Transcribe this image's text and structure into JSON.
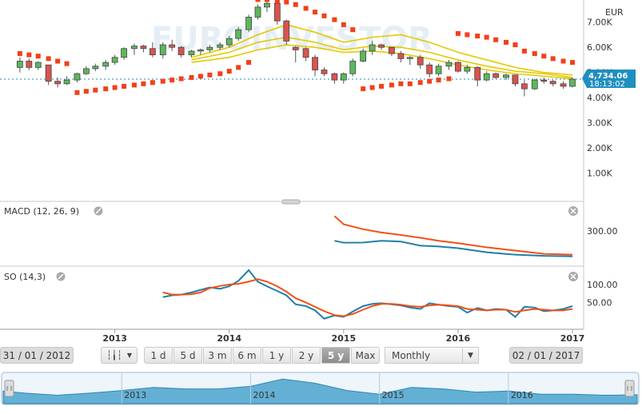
{
  "header": {
    "currency": "EUR"
  },
  "price": {
    "last": "4,734.06",
    "time": "18:13:02"
  },
  "panels": {
    "macd": {
      "title": "MACD (12, 26, 9)"
    },
    "so": {
      "title": "SO (14,3)"
    }
  },
  "controls": {
    "start_date": "31 / 01 / 2012",
    "end_date": "02 / 01 / 2017",
    "ranges": [
      "1 d",
      "5 d",
      "3 m",
      "6 m",
      "1 y",
      "2 y",
      "5 y",
      "Max"
    ],
    "active_range": "5 y",
    "interval": "Monthly"
  },
  "navigator": {
    "years": [
      "2013",
      "2014",
      "2015",
      "2016"
    ]
  },
  "colors": {
    "up": "#5cb85c",
    "down": "#d9534f",
    "psar": "#f2401a",
    "ma": "#e6c800",
    "macd_line": "#1f7fa8",
    "signal_line": "#f25018",
    "so_k": "#1f7fa8",
    "so_d": "#f25018",
    "last_price": "#1f8fbf"
  },
  "chart_data": [
    {
      "type": "candlestick",
      "name": "price",
      "y_ticks": [
        "1.00K",
        "2.00K",
        "3.00K",
        "4.00K",
        "5.00K",
        "6.00K",
        "7.00K"
      ],
      "ylim": [
        0,
        7500
      ],
      "x_ticks": [
        "2013",
        "2014",
        "2015",
        "2016",
        "2017"
      ],
      "xlim": [
        2012.08,
        2017.0
      ],
      "last_price": 4734.06,
      "candles": [
        [
          2012.17,
          5200,
          5600,
          5000,
          5450
        ],
        [
          2012.25,
          5450,
          5550,
          5100,
          5200
        ],
        [
          2012.33,
          5200,
          5450,
          5100,
          5400
        ],
        [
          2012.42,
          5300,
          5300,
          4500,
          4650
        ],
        [
          2012.5,
          4650,
          4800,
          4400,
          4550
        ],
        [
          2012.58,
          4550,
          4850,
          4500,
          4700
        ],
        [
          2012.67,
          4700,
          5000,
          4600,
          4950
        ],
        [
          2012.75,
          4950,
          5250,
          4900,
          5150
        ],
        [
          2012.83,
          5150,
          5350,
          5050,
          5250
        ],
        [
          2012.92,
          5250,
          5500,
          5100,
          5400
        ],
        [
          2013.0,
          5400,
          5700,
          5300,
          5600
        ],
        [
          2013.08,
          5600,
          6000,
          5500,
          5950
        ],
        [
          2013.17,
          5950,
          6150,
          5700,
          6050
        ],
        [
          2013.25,
          6050,
          6100,
          5800,
          5950
        ],
        [
          2013.33,
          5950,
          6200,
          5600,
          5700
        ],
        [
          2013.42,
          5700,
          6200,
          5550,
          6100
        ],
        [
          2013.5,
          6100,
          6300,
          5850,
          6000
        ],
        [
          2013.58,
          6000,
          6050,
          5600,
          5700
        ],
        [
          2013.67,
          5700,
          5900,
          5600,
          5850
        ],
        [
          2013.75,
          5850,
          5950,
          5700,
          5900
        ],
        [
          2013.83,
          5900,
          6100,
          5800,
          6000
        ],
        [
          2013.92,
          6000,
          6200,
          5900,
          6100
        ],
        [
          2014.0,
          6100,
          6450,
          6000,
          6350
        ],
        [
          2014.08,
          6350,
          6800,
          6250,
          6700
        ],
        [
          2014.17,
          6700,
          7300,
          6600,
          7200
        ],
        [
          2014.25,
          7200,
          7700,
          7100,
          7600
        ],
        [
          2014.33,
          7600,
          7850,
          7400,
          7750
        ],
        [
          2014.42,
          7750,
          7800,
          6900,
          7050
        ],
        [
          2014.5,
          7050,
          7100,
          6100,
          6250
        ],
        [
          2014.58,
          6000,
          6050,
          5400,
          5900
        ],
        [
          2014.67,
          5950,
          6000,
          5450,
          5600
        ],
        [
          2014.75,
          5600,
          5700,
          4850,
          5100
        ],
        [
          2014.83,
          5100,
          5200,
          4850,
          4950
        ],
        [
          2014.92,
          4950,
          5000,
          4550,
          4700
        ],
        [
          2015.0,
          4700,
          5000,
          4550,
          4950
        ],
        [
          2015.08,
          4950,
          5550,
          4850,
          5450
        ],
        [
          2015.17,
          5450,
          5950,
          5400,
          5850
        ],
        [
          2015.25,
          5850,
          6250,
          5700,
          6100
        ],
        [
          2015.33,
          6100,
          6150,
          5900,
          6000
        ],
        [
          2015.42,
          6000,
          6000,
          5650,
          5750
        ],
        [
          2015.5,
          5750,
          5850,
          5400,
          5550
        ],
        [
          2015.58,
          5550,
          5650,
          5300,
          5600
        ],
        [
          2015.67,
          5600,
          5700,
          5150,
          5300
        ],
        [
          2015.75,
          5300,
          5400,
          4800,
          4950
        ],
        [
          2015.83,
          4950,
          5350,
          4850,
          5250
        ],
        [
          2015.92,
          5250,
          5500,
          5100,
          5400
        ],
        [
          2016.0,
          5400,
          5450,
          5000,
          5050
        ],
        [
          2016.08,
          5050,
          5300,
          4950,
          5200
        ],
        [
          2016.17,
          5200,
          5250,
          4450,
          4700
        ],
        [
          2016.25,
          4700,
          5050,
          4650,
          4950
        ],
        [
          2016.33,
          4950,
          5000,
          4750,
          4800
        ],
        [
          2016.42,
          4800,
          4950,
          4700,
          4900
        ],
        [
          2016.5,
          4900,
          4900,
          4450,
          4550
        ],
        [
          2016.58,
          4550,
          4700,
          4050,
          4350
        ],
        [
          2016.67,
          4350,
          4750,
          4300,
          4700
        ],
        [
          2016.75,
          4700,
          4800,
          4550,
          4650
        ],
        [
          2016.83,
          4650,
          4700,
          4450,
          4550
        ],
        [
          2016.92,
          4550,
          4650,
          4350,
          4450
        ],
        [
          2017.0,
          4450,
          4800,
          4400,
          4734
        ]
      ],
      "psar": [
        [
          2012.17,
          5750
        ],
        [
          2012.25,
          5700
        ],
        [
          2012.33,
          5650
        ],
        [
          2012.42,
          5550
        ],
        [
          2012.5,
          5450
        ],
        [
          2012.58,
          5350
        ],
        [
          2012.67,
          4200
        ],
        [
          2012.75,
          4250
        ],
        [
          2012.83,
          4300
        ],
        [
          2012.92,
          4350
        ],
        [
          2013.0,
          4400
        ],
        [
          2013.08,
          4450
        ],
        [
          2013.17,
          4500
        ],
        [
          2013.25,
          4550
        ],
        [
          2013.33,
          4600
        ],
        [
          2013.42,
          4650
        ],
        [
          2013.5,
          4700
        ],
        [
          2013.58,
          4750
        ],
        [
          2013.67,
          4800
        ],
        [
          2013.75,
          4850
        ],
        [
          2013.83,
          4900
        ],
        [
          2013.92,
          4950
        ],
        [
          2014.0,
          5050
        ],
        [
          2014.08,
          5200
        ],
        [
          2014.17,
          5400
        ],
        [
          2014.25,
          7900
        ],
        [
          2014.33,
          7900
        ],
        [
          2014.42,
          7850
        ],
        [
          2014.5,
          7800
        ],
        [
          2014.58,
          7700
        ],
        [
          2014.67,
          7550
        ],
        [
          2014.75,
          7400
        ],
        [
          2014.83,
          7250
        ],
        [
          2014.92,
          7100
        ],
        [
          2015.0,
          6900
        ],
        [
          2015.08,
          6700
        ],
        [
          2015.17,
          4350
        ],
        [
          2015.25,
          4400
        ],
        [
          2015.33,
          4450
        ],
        [
          2015.42,
          4500
        ],
        [
          2015.5,
          4550
        ],
        [
          2015.58,
          4550
        ],
        [
          2015.67,
          4600
        ],
        [
          2015.75,
          4650
        ],
        [
          2015.83,
          4700
        ],
        [
          2015.92,
          4750
        ],
        [
          2016.0,
          6550
        ],
        [
          2016.08,
          6500
        ],
        [
          2016.17,
          6450
        ],
        [
          2016.25,
          6400
        ],
        [
          2016.33,
          6300
        ],
        [
          2016.42,
          6200
        ],
        [
          2016.5,
          6100
        ],
        [
          2016.58,
          5850
        ],
        [
          2016.67,
          5750
        ],
        [
          2016.75,
          5650
        ],
        [
          2016.83,
          5550
        ],
        [
          2016.92,
          5450
        ],
        [
          2017.0,
          5400
        ]
      ],
      "moving_averages": [
        [
          [
            2013.67,
            5600
          ],
          [
            2014.0,
            6000
          ],
          [
            2014.25,
            6500
          ],
          [
            2014.5,
            6900
          ],
          [
            2014.75,
            6600
          ],
          [
            2015.0,
            6200
          ],
          [
            2015.25,
            6400
          ],
          [
            2015.5,
            6500
          ],
          [
            2015.75,
            6200
          ],
          [
            2016.0,
            5800
          ],
          [
            2016.25,
            5500
          ],
          [
            2016.5,
            5200
          ],
          [
            2016.75,
            5000
          ],
          [
            2017.0,
            4900
          ]
        ],
        [
          [
            2013.67,
            5500
          ],
          [
            2014.0,
            5800
          ],
          [
            2014.25,
            6200
          ],
          [
            2014.5,
            6400
          ],
          [
            2014.75,
            6200
          ],
          [
            2015.0,
            5900
          ],
          [
            2015.25,
            6050
          ],
          [
            2015.5,
            6000
          ],
          [
            2015.75,
            5800
          ],
          [
            2016.0,
            5500
          ],
          [
            2016.25,
            5250
          ],
          [
            2016.5,
            5050
          ],
          [
            2016.75,
            4950
          ],
          [
            2017.0,
            4800
          ]
        ],
        [
          [
            2013.67,
            5400
          ],
          [
            2014.0,
            5600
          ],
          [
            2014.25,
            5900
          ],
          [
            2014.5,
            6100
          ],
          [
            2014.75,
            6000
          ],
          [
            2015.0,
            5800
          ],
          [
            2015.25,
            5850
          ],
          [
            2015.5,
            5750
          ],
          [
            2015.75,
            5550
          ],
          [
            2016.0,
            5300
          ],
          [
            2016.25,
            5100
          ],
          [
            2016.5,
            4950
          ],
          [
            2016.75,
            4850
          ],
          [
            2017.0,
            4750
          ]
        ]
      ]
    },
    {
      "type": "line",
      "name": "macd",
      "title": "MACD (12, 26, 9)",
      "y_ticks": [
        "300.00"
      ],
      "ylim": [
        100,
        450
      ],
      "series": [
        {
          "name": "MACD",
          "x": [
            2014.92,
            2015.0,
            2015.17,
            2015.33,
            2015.5,
            2015.67,
            2015.83,
            2016.0,
            2016.25,
            2016.5,
            2016.75,
            2017.0
          ],
          "values": [
            240,
            228,
            229,
            240,
            235,
            210,
            205,
            195,
            170,
            155,
            148,
            145
          ]
        },
        {
          "name": "Signal",
          "x": [
            2014.92,
            2015.0,
            2015.17,
            2015.33,
            2015.5,
            2015.67,
            2015.83,
            2016.0,
            2016.25,
            2016.5,
            2016.75,
            2017.0
          ],
          "values": [
            390,
            340,
            310,
            290,
            275,
            258,
            240,
            225,
            200,
            180,
            160,
            155
          ]
        }
      ]
    },
    {
      "type": "line",
      "name": "so",
      "title": "SO (14,3)",
      "y_ticks": [
        "100.00",
        "50.00"
      ],
      "ylim": [
        -20,
        140
      ],
      "series": [
        {
          "name": "%K",
          "x": [
            2013.42,
            2013.5,
            2013.58,
            2013.67,
            2013.75,
            2013.83,
            2013.92,
            2014.0,
            2014.08,
            2014.17,
            2014.25,
            2014.33,
            2014.42,
            2014.5,
            2014.58,
            2014.67,
            2014.75,
            2014.83,
            2014.92,
            2015.0,
            2015.08,
            2015.17,
            2015.25,
            2015.33,
            2015.42,
            2015.5,
            2015.58,
            2015.67,
            2015.75,
            2015.83,
            2015.92,
            2016.0,
            2016.08,
            2016.17,
            2016.25,
            2016.33,
            2016.42,
            2016.5,
            2016.58,
            2016.67,
            2016.75,
            2016.83,
            2016.92,
            2017.0
          ],
          "values": [
            65,
            70,
            72,
            78,
            85,
            92,
            88,
            95,
            110,
            140,
            108,
            95,
            82,
            70,
            45,
            40,
            28,
            5,
            14,
            10,
            25,
            40,
            46,
            48,
            45,
            42,
            36,
            32,
            48,
            44,
            40,
            38,
            22,
            35,
            28,
            32,
            30,
            10,
            38,
            36,
            26,
            28,
            32,
            40
          ]
        },
        {
          "name": "%D",
          "x": [
            2013.42,
            2013.5,
            2013.58,
            2013.67,
            2013.75,
            2013.83,
            2013.92,
            2014.0,
            2014.08,
            2014.17,
            2014.25,
            2014.33,
            2014.42,
            2014.5,
            2014.58,
            2014.67,
            2014.75,
            2014.83,
            2014.92,
            2015.0,
            2015.08,
            2015.17,
            2015.25,
            2015.33,
            2015.42,
            2015.5,
            2015.58,
            2015.67,
            2015.75,
            2015.83,
            2015.92,
            2016.0,
            2016.08,
            2016.17,
            2016.25,
            2016.33,
            2016.42,
            2016.5,
            2016.58,
            2016.67,
            2016.75,
            2016.83,
            2016.92,
            2017.0
          ],
          "values": [
            78,
            72,
            72,
            73,
            78,
            90,
            96,
            100,
            102,
            108,
            115,
            108,
            95,
            80,
            62,
            50,
            38,
            26,
            15,
            12,
            18,
            30,
            40,
            46,
            46,
            44,
            40,
            38,
            42,
            44,
            42,
            40,
            32,
            30,
            28,
            30,
            30,
            24,
            28,
            32,
            30,
            28,
            28,
            32
          ]
        }
      ]
    },
    {
      "type": "area",
      "name": "navigator",
      "xlim": [
        2012.08,
        2017.0
      ],
      "ylim": [
        3000,
        8500
      ],
      "x": [
        2012.08,
        2012.25,
        2012.5,
        2012.75,
        2013.0,
        2013.25,
        2013.5,
        2013.75,
        2014.0,
        2014.25,
        2014.5,
        2014.75,
        2015.0,
        2015.25,
        2015.5,
        2015.75,
        2016.0,
        2016.25,
        2016.5,
        2016.75,
        2017.0
      ],
      "values": [
        5400,
        5000,
        4600,
        5000,
        5500,
        6100,
        5800,
        5800,
        6300,
        7700,
        6900,
        5500,
        4800,
        6100,
        5800,
        5200,
        5400,
        4800,
        4800,
        4600,
        4700
      ]
    }
  ]
}
